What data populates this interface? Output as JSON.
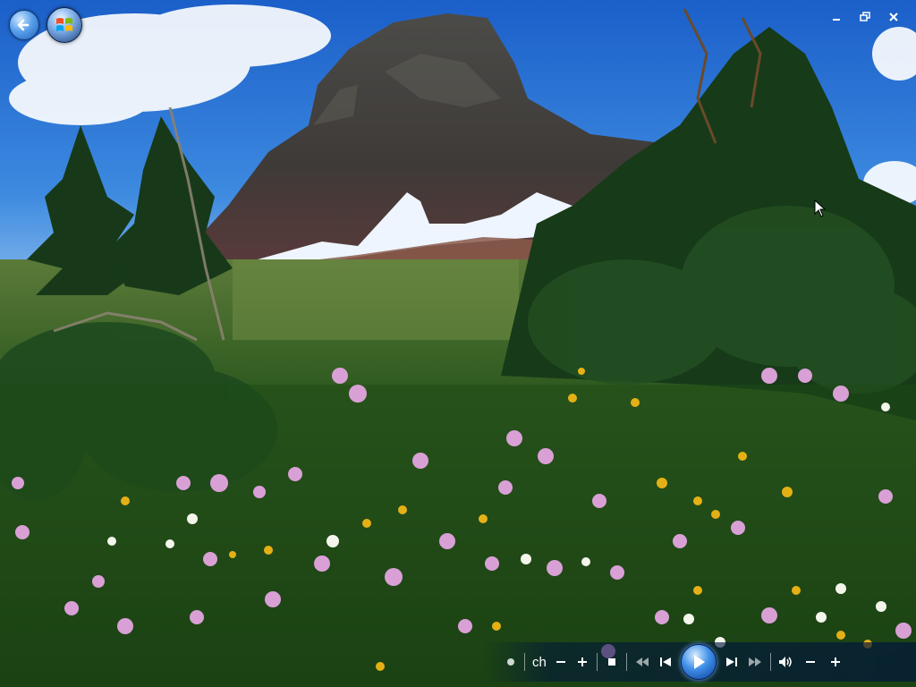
{
  "window": {
    "controls": {
      "minimize_icon": "minimize-icon",
      "restore_icon": "restore-icon",
      "close_icon": "close-icon"
    }
  },
  "top_left": {
    "back_icon": "back-arrow-icon",
    "start_icon": "windows-orb-icon"
  },
  "player": {
    "channel_label": "ch",
    "icons": [
      "dot-icon",
      "channel-down-icon",
      "channel-up-icon",
      "stop-icon",
      "rewind-icon",
      "previous-icon",
      "play-icon",
      "next-icon",
      "fast-forward-icon",
      "volume-icon",
      "volume-down-icon",
      "volume-up-icon"
    ]
  },
  "colors": {
    "accent": "#1e6fd9",
    "sky": "#1f6fd0"
  }
}
